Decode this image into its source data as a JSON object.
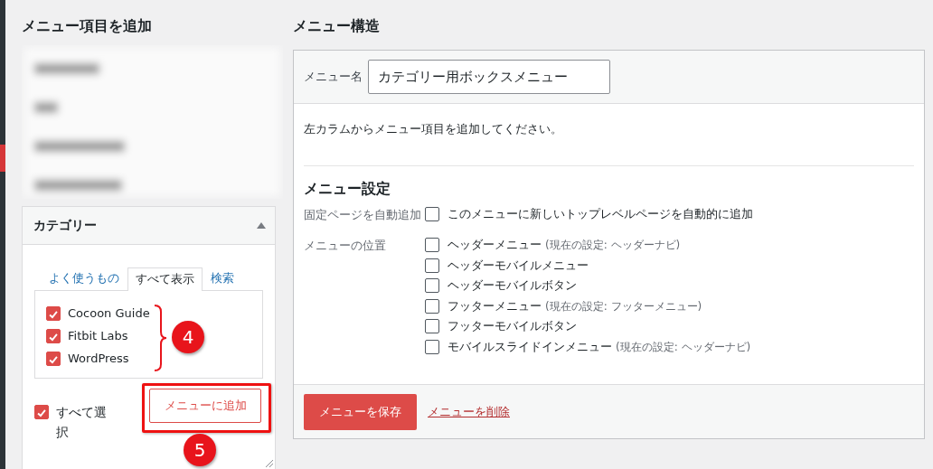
{
  "left": {
    "title": "メニュー項目を追加",
    "category_box": {
      "title": "カテゴリー",
      "expanded": true,
      "tabs": [
        {
          "label": "よく使うもの",
          "selected": false
        },
        {
          "label": "すべて表示",
          "selected": true
        },
        {
          "label": "検索",
          "selected": false
        }
      ],
      "items": [
        {
          "label": "Cocoon Guide",
          "checked": true
        },
        {
          "label": "Fitbit Labs",
          "checked": true
        },
        {
          "label": "WordPress",
          "checked": true
        }
      ],
      "select_all": {
        "label": "すべて選択",
        "checked": true
      },
      "add_button": "メニューに追加"
    }
  },
  "right": {
    "title": "メニュー構造",
    "menu_name": {
      "label": "メニュー名",
      "value": "カテゴリー用ボックスメニュー"
    },
    "hint": "左カラムからメニュー項目を追加してください。",
    "settings": {
      "title": "メニュー設定",
      "auto_add": {
        "label": "固定ページを自動追加",
        "option": "このメニューに新しいトップレベルページを自動的に追加",
        "checked": false
      },
      "locations_label": "メニューの位置",
      "locations": [
        {
          "label": "ヘッダーメニュー",
          "note": "(現在の設定: ヘッダーナビ)",
          "checked": false
        },
        {
          "label": "ヘッダーモバイルメニュー",
          "checked": false
        },
        {
          "label": "ヘッダーモバイルボタン",
          "checked": false
        },
        {
          "label": "フッターメニュー",
          "note": "(現在の設定: フッターメニュー)",
          "checked": false
        },
        {
          "label": "フッターモバイルボタン",
          "checked": false
        },
        {
          "label": "モバイルスライドインメニュー",
          "note": "(現在の設定: ヘッダーナビ)",
          "checked": false
        }
      ]
    },
    "save_button": "メニューを保存",
    "delete_link": "メニューを削除"
  },
  "annotations": [
    {
      "label": "4"
    },
    {
      "label": "5"
    }
  ]
}
